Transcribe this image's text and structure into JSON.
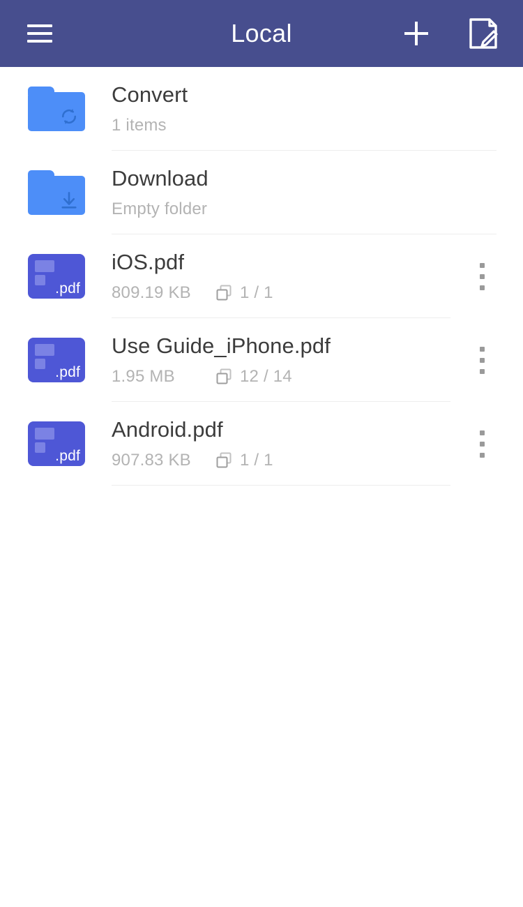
{
  "appbar": {
    "title": "Local",
    "menu_icon": "hamburger-menu-icon",
    "add_icon": "plus-icon",
    "edit_icon": "note-edit-icon",
    "background_color": "#474E8E",
    "text_color": "#FFFFFF"
  },
  "colors": {
    "folder_blue": "#4D8EF8",
    "pdf_indigo": "#4E57D6",
    "title_text": "#3C3C3C",
    "meta_text": "#B3B3B3",
    "divider": "#EDEDED",
    "page_background": "#FFFFFF"
  },
  "list": {
    "items": [
      {
        "kind": "folder",
        "icon": "folder-sync-icon",
        "name": "Convert",
        "subtitle": "1 items",
        "size": "",
        "pages": "",
        "has_menu": false
      },
      {
        "kind": "folder",
        "icon": "folder-download-icon",
        "name": "Download",
        "subtitle": "Empty folder",
        "size": "",
        "pages": "",
        "has_menu": false
      },
      {
        "kind": "pdf",
        "icon": "pdf-file-icon",
        "extension": ".pdf",
        "name": "iOS.pdf",
        "subtitle": "",
        "size": "809.19 KB",
        "pages": "1 / 1",
        "has_menu": true
      },
      {
        "kind": "pdf",
        "icon": "pdf-file-icon",
        "extension": ".pdf",
        "name": "Use Guide_iPhone.pdf",
        "subtitle": "",
        "size": "1.95 MB",
        "pages": "12 / 14",
        "has_menu": true
      },
      {
        "kind": "pdf",
        "icon": "pdf-file-icon",
        "extension": ".pdf",
        "name": "Android.pdf",
        "subtitle": "",
        "size": "907.83 KB",
        "pages": "1 / 1",
        "has_menu": true
      }
    ]
  }
}
